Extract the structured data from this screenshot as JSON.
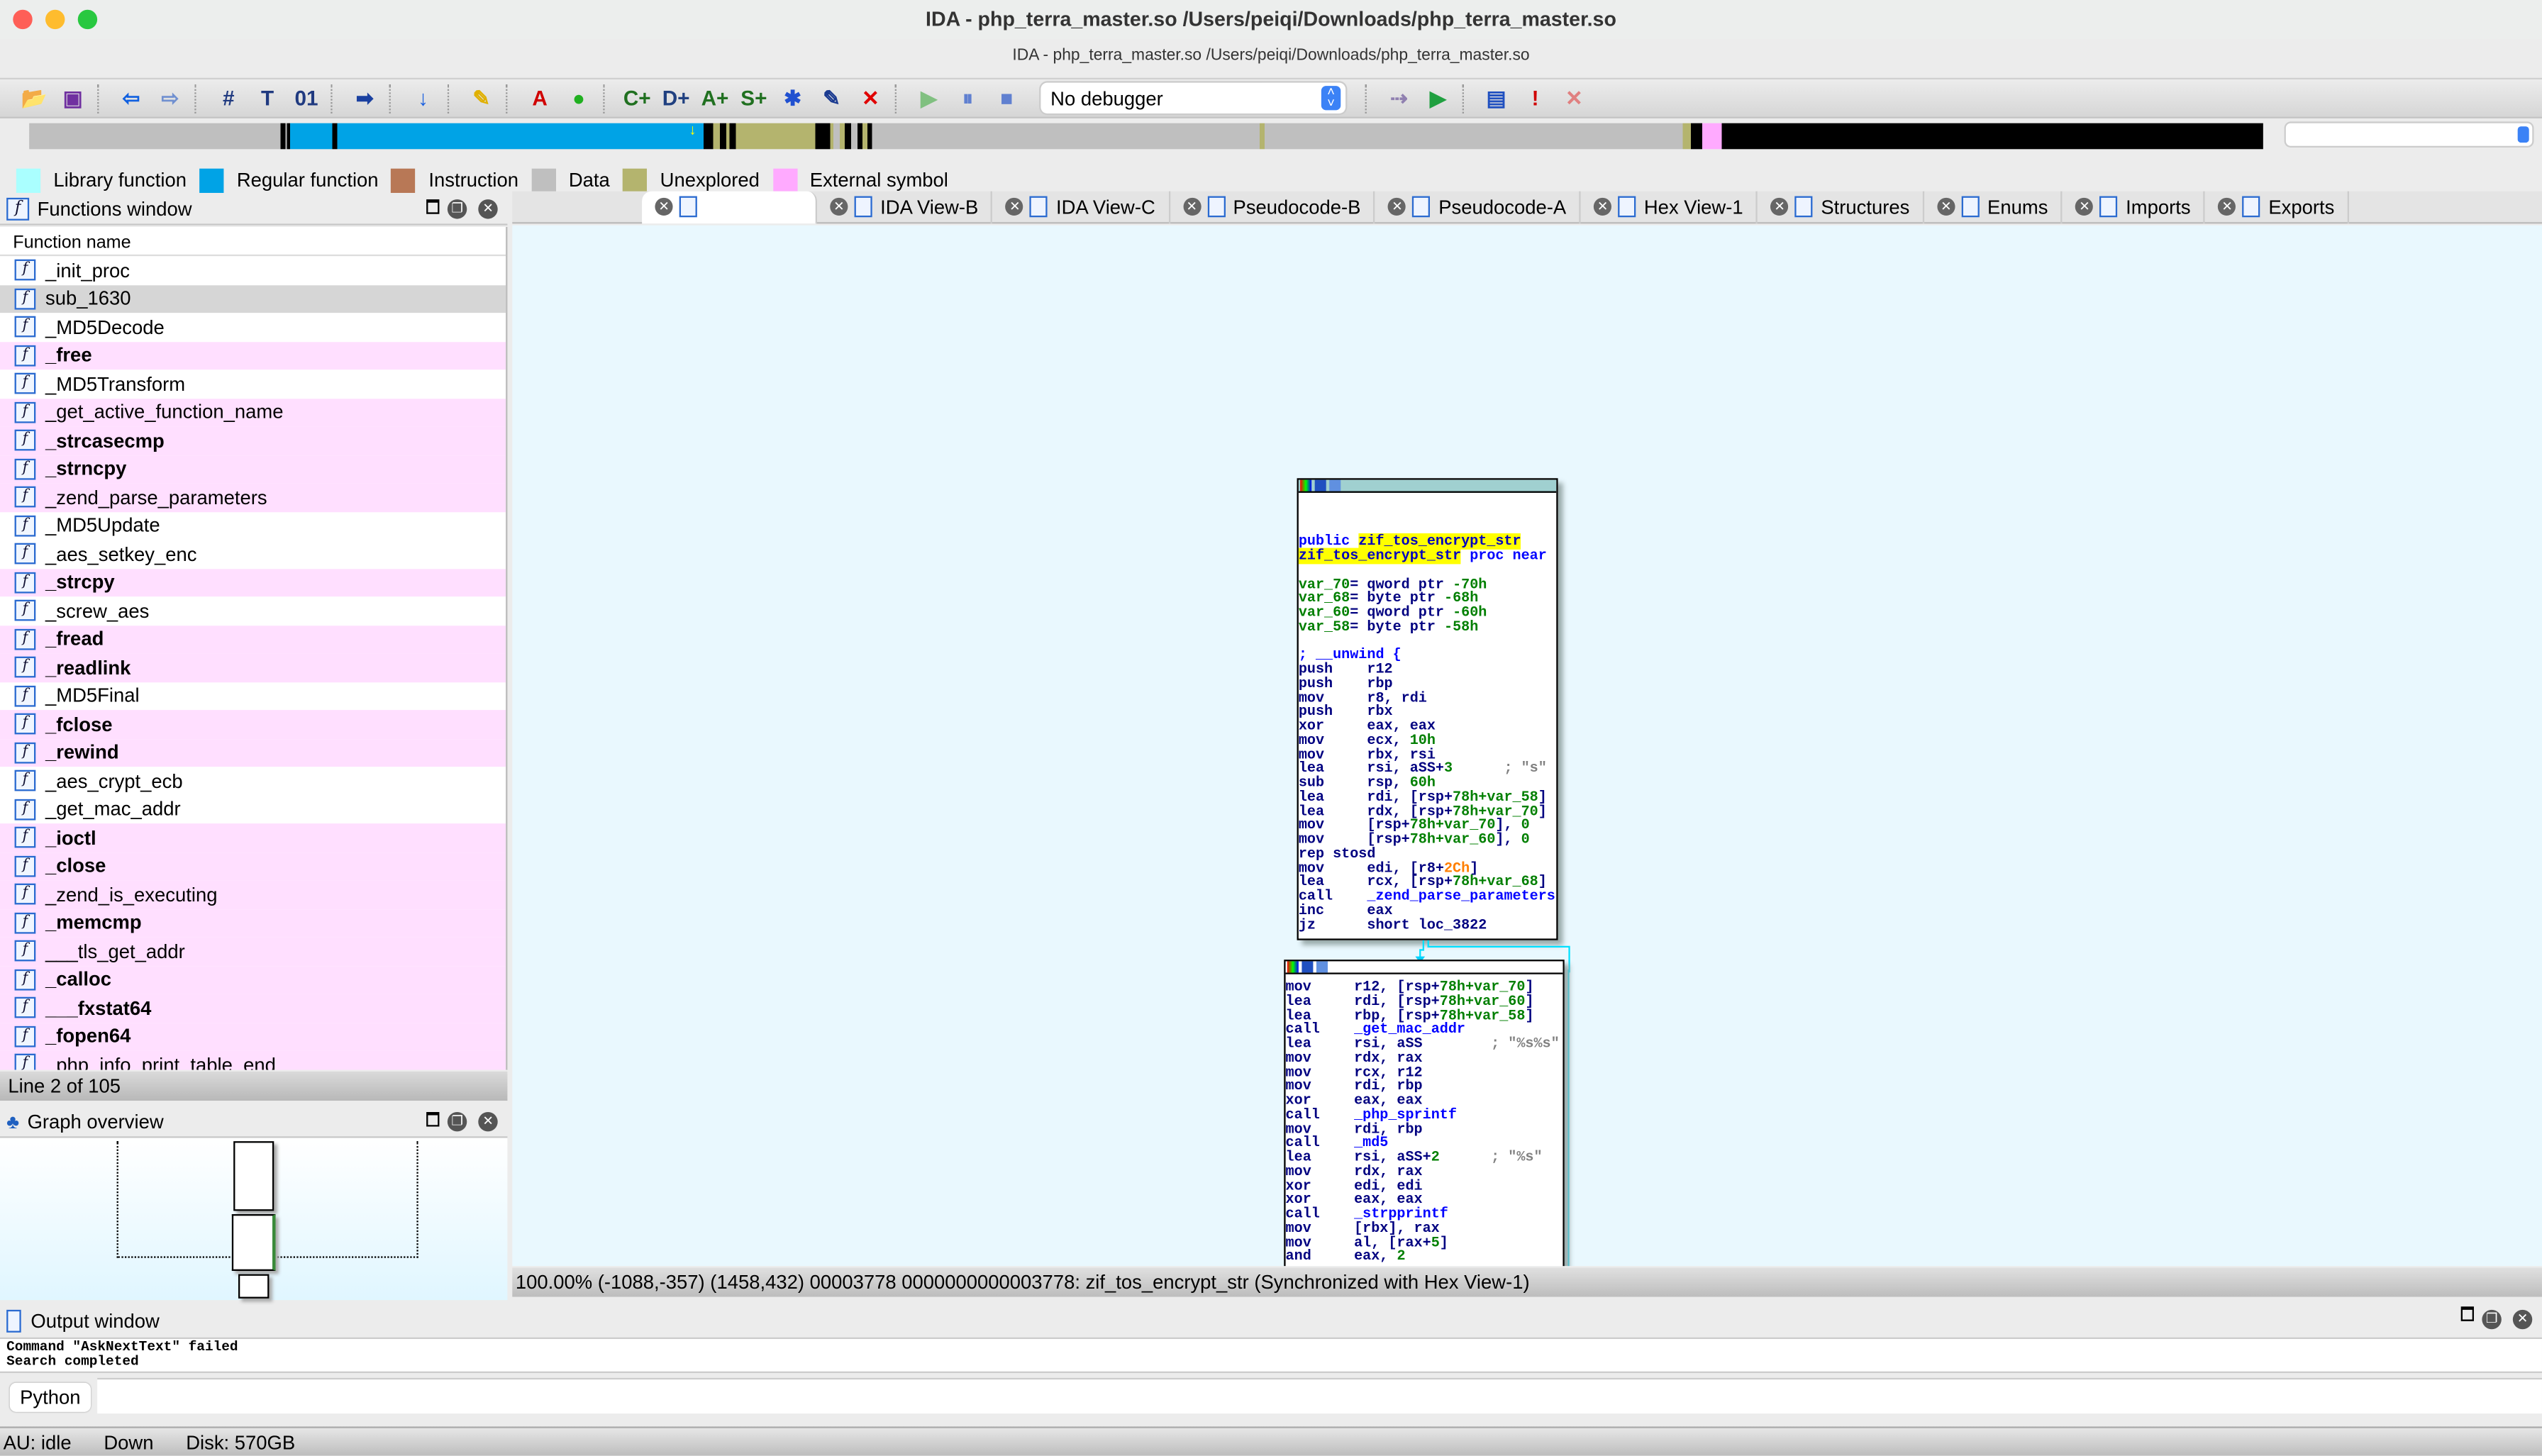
{
  "window": {
    "title": "IDA - php_terra_master.so /Users/peiqi/Downloads/php_terra_master.so",
    "subtitle": "IDA - php_terra_master.so /Users/peiqi/Downloads/php_terra_master.so"
  },
  "toolbar": {
    "icons": [
      {
        "name": "open-icon",
        "glyph": "📂",
        "color": "#d4a017"
      },
      {
        "name": "save-icon",
        "glyph": "▣",
        "color": "#7030a0"
      },
      {
        "sep": true
      },
      {
        "name": "back-icon",
        "glyph": "⇦",
        "color": "#1060e0"
      },
      {
        "name": "forward-icon",
        "glyph": "⇨",
        "color": "#7090d0"
      },
      {
        "sep": true
      },
      {
        "name": "search-sequence-icon",
        "glyph": "#",
        "color": "#203a80"
      },
      {
        "name": "search-text-icon",
        "glyph": "T",
        "color": "#203a80"
      },
      {
        "name": "search-binary-icon",
        "glyph": "01",
        "color": "#203a80"
      },
      {
        "sep": true
      },
      {
        "name": "jump-icon",
        "glyph": "➡",
        "color": "#1a40a0"
      },
      {
        "sep": true
      },
      {
        "name": "jump-down-icon",
        "glyph": "↓",
        "color": "#1a60e0"
      },
      {
        "sep": true
      },
      {
        "name": "flashlight-icon",
        "glyph": "✎",
        "color": "#e0b000"
      },
      {
        "sep": true
      },
      {
        "name": "strings-icon",
        "glyph": "A",
        "color": "#d00000"
      },
      {
        "name": "green-circle-icon",
        "glyph": "●",
        "color": "#20b020"
      },
      {
        "sep": true
      },
      {
        "name": "create-code-icon",
        "glyph": "C+",
        "color": "#207020"
      },
      {
        "name": "create-data-icon",
        "glyph": "D+",
        "color": "#204080"
      },
      {
        "name": "create-string-icon",
        "glyph": "A+",
        "color": "#207020"
      },
      {
        "name": "create-struct-icon",
        "glyph": "S+",
        "color": "#207020"
      },
      {
        "name": "enum-add-icon",
        "glyph": "✱",
        "color": "#2050d0"
      },
      {
        "name": "edit-icon",
        "glyph": "✎",
        "color": "#1a3a90"
      },
      {
        "name": "delete-icon",
        "glyph": "✕",
        "color": "#e00000"
      },
      {
        "sep": true
      },
      {
        "name": "play-icon",
        "glyph": "▶",
        "color": "#80c080"
      },
      {
        "name": "pause-icon",
        "glyph": "⏸",
        "color": "#6080d0"
      },
      {
        "name": "stop-icon",
        "glyph": "■",
        "color": "#6080d0"
      }
    ],
    "debugger_select": "No debugger",
    "icons_right": [
      {
        "name": "attach-icon",
        "glyph": "⇢",
        "color": "#9080b0"
      },
      {
        "name": "run-to-cursor-icon",
        "glyph": "▶",
        "color": "#20a040"
      },
      {
        "sep": true
      },
      {
        "name": "breakpoint-list-icon",
        "glyph": "▤",
        "color": "#2050c0"
      },
      {
        "name": "add-breakpoint-icon",
        "glyph": "!",
        "color": "#d00000"
      },
      {
        "name": "delete-breakpoint-icon",
        "glyph": "✕",
        "color": "#e08080"
      }
    ]
  },
  "legend": [
    {
      "label": "Library function",
      "color": "#aaffff"
    },
    {
      "label": "Regular function",
      "color": "#00a3e6"
    },
    {
      "label": "Instruction",
      "color": "#b87856"
    },
    {
      "label": "Data",
      "color": "#bfbfbf"
    },
    {
      "label": "Unexplored",
      "color": "#b4b46e"
    },
    {
      "label": "External symbol",
      "color": "#ffaaff"
    }
  ],
  "functions_window": {
    "title": "Functions window",
    "column": "Function name",
    "rows": [
      {
        "name": "_init_proc",
        "type": "regular"
      },
      {
        "name": "sub_1630",
        "type": "regular",
        "selected": true
      },
      {
        "name": "_MD5Decode",
        "type": "regular"
      },
      {
        "name": "_free",
        "type": "external",
        "bold": true
      },
      {
        "name": "_MD5Transform",
        "type": "regular"
      },
      {
        "name": "_get_active_function_name",
        "type": "external"
      },
      {
        "name": "_strcasecmp",
        "type": "external",
        "bold": true
      },
      {
        "name": "_strncpy",
        "type": "external",
        "bold": true
      },
      {
        "name": "_zend_parse_parameters",
        "type": "external"
      },
      {
        "name": "_MD5Update",
        "type": "regular"
      },
      {
        "name": "_aes_setkey_enc",
        "type": "regular"
      },
      {
        "name": "_strcpy",
        "type": "external",
        "bold": true
      },
      {
        "name": "_screw_aes",
        "type": "regular"
      },
      {
        "name": "_fread",
        "type": "external",
        "bold": true
      },
      {
        "name": "_readlink",
        "type": "external",
        "bold": true
      },
      {
        "name": "_MD5Final",
        "type": "regular"
      },
      {
        "name": "_fclose",
        "type": "external",
        "bold": true
      },
      {
        "name": "_rewind",
        "type": "external",
        "bold": true
      },
      {
        "name": "_aes_crypt_ecb",
        "type": "regular"
      },
      {
        "name": "_get_mac_addr",
        "type": "regular"
      },
      {
        "name": "_ioctl",
        "type": "external",
        "bold": true
      },
      {
        "name": "_close",
        "type": "external",
        "bold": true
      },
      {
        "name": "_zend_is_executing",
        "type": "external"
      },
      {
        "name": "_memcmp",
        "type": "external",
        "bold": true
      },
      {
        "name": "___tls_get_addr",
        "type": "external"
      },
      {
        "name": "_calloc",
        "type": "external",
        "bold": true
      },
      {
        "name": "___fxstat64",
        "type": "external",
        "bold": true
      },
      {
        "name": "_fopen64",
        "type": "external",
        "bold": true
      },
      {
        "name": "_php_info_print_table_end",
        "type": "external"
      }
    ],
    "status": "Line 2 of 105"
  },
  "graph_overview": {
    "title": "Graph overview"
  },
  "tabs": [
    {
      "label": "",
      "active": true
    },
    {
      "label": "IDA View-B"
    },
    {
      "label": "IDA View-C"
    },
    {
      "label": "Pseudocode-B"
    },
    {
      "label": "Pseudocode-A"
    },
    {
      "label": "Hex View-1"
    },
    {
      "label": "Structures"
    },
    {
      "label": "Enums"
    },
    {
      "label": "Imports"
    },
    {
      "label": "Exports"
    }
  ],
  "graph": {
    "blocks": [
      {
        "lines": [
          [],
          [],
          [],
          [
            [
              "b",
              "public "
            ],
            [
              "h",
              "zif_tos_encrypt_str"
            ]
          ],
          [
            [
              "h",
              "zif_tos_encrypt_str"
            ],
            [
              "b",
              " proc near"
            ]
          ],
          [],
          [
            [
              "g",
              "var_70"
            ],
            [
              "n",
              "= qword ptr "
            ],
            [
              "g",
              "-70h"
            ]
          ],
          [
            [
              "g",
              "var_68"
            ],
            [
              "n",
              "= byte ptr "
            ],
            [
              "g",
              "-68h"
            ]
          ],
          [
            [
              "g",
              "var_60"
            ],
            [
              "n",
              "= qword ptr "
            ],
            [
              "g",
              "-60h"
            ]
          ],
          [
            [
              "g",
              "var_58"
            ],
            [
              "n",
              "= byte ptr "
            ],
            [
              "g",
              "-58h"
            ]
          ],
          [],
          [
            [
              "b",
              "; __unwind {"
            ]
          ],
          [
            [
              "n",
              "push    r12"
            ]
          ],
          [
            [
              "n",
              "push    rbp"
            ]
          ],
          [
            [
              "n",
              "mov     r8, rdi"
            ]
          ],
          [
            [
              "n",
              "push    rbx"
            ]
          ],
          [
            [
              "n",
              "xor     eax, eax"
            ]
          ],
          [
            [
              "n",
              "mov     ecx, "
            ],
            [
              "g",
              "10h"
            ]
          ],
          [
            [
              "n",
              "mov     rbx, rsi"
            ]
          ],
          [
            [
              "n",
              "lea     rsi, aSS+"
            ],
            [
              "g",
              "3"
            ],
            [
              "c",
              "      ; \"s\""
            ]
          ],
          [
            [
              "n",
              "sub     rsp, "
            ],
            [
              "g",
              "60h"
            ]
          ],
          [
            [
              "n",
              "lea     rdi, [rsp+"
            ],
            [
              "g",
              "78h+var_58"
            ],
            [
              "n",
              "]"
            ]
          ],
          [
            [
              "n",
              "lea     rdx, [rsp+"
            ],
            [
              "g",
              "78h+var_70"
            ],
            [
              "n",
              "]"
            ]
          ],
          [
            [
              "n",
              "mov     [rsp+"
            ],
            [
              "g",
              "78h+var_70"
            ],
            [
              "n",
              "], "
            ],
            [
              "g",
              "0"
            ]
          ],
          [
            [
              "n",
              "mov     [rsp+"
            ],
            [
              "g",
              "78h+var_60"
            ],
            [
              "n",
              "], "
            ],
            [
              "g",
              "0"
            ]
          ],
          [
            [
              "n",
              "rep stosd"
            ]
          ],
          [
            [
              "n",
              "mov     edi, [r8+"
            ],
            [
              "o",
              "2Ch"
            ],
            [
              "n",
              "]"
            ]
          ],
          [
            [
              "n",
              "lea     rcx, [rsp+"
            ],
            [
              "g",
              "78h+var_68"
            ],
            [
              "n",
              "]"
            ]
          ],
          [
            [
              "n",
              "call    "
            ],
            [
              "b",
              "_zend_parse_parameters"
            ]
          ],
          [
            [
              "n",
              "inc     eax"
            ]
          ],
          [
            [
              "n",
              "jz      short loc_3822"
            ]
          ]
        ]
      },
      {
        "lines": [
          [
            [
              "n",
              "mov     r12, [rsp+"
            ],
            [
              "g",
              "78h+var_70"
            ],
            [
              "n",
              "]"
            ]
          ],
          [
            [
              "n",
              "lea     rdi, [rsp+"
            ],
            [
              "g",
              "78h+var_60"
            ],
            [
              "n",
              "]"
            ]
          ],
          [
            [
              "n",
              "lea     rbp, [rsp+"
            ],
            [
              "g",
              "78h+var_58"
            ],
            [
              "n",
              "]"
            ]
          ],
          [
            [
              "n",
              "call    "
            ],
            [
              "b",
              "_get_mac_addr"
            ]
          ],
          [
            [
              "n",
              "lea     rsi, aSS"
            ],
            [
              "c",
              "        ; \"%s%s\""
            ]
          ],
          [
            [
              "n",
              "mov     rdx, rax"
            ]
          ],
          [
            [
              "n",
              "mov     rcx, r12"
            ]
          ],
          [
            [
              "n",
              "mov     rdi, rbp"
            ]
          ],
          [
            [
              "n",
              "xor     eax, eax"
            ]
          ],
          [
            [
              "n",
              "call    "
            ],
            [
              "b",
              "_php_sprintf"
            ]
          ],
          [
            [
              "n",
              "mov     rdi, rbp"
            ]
          ],
          [
            [
              "n",
              "call    "
            ],
            [
              "b",
              "_md5"
            ]
          ],
          [
            [
              "n",
              "lea     rsi, aSS+"
            ],
            [
              "g",
              "2"
            ],
            [
              "c",
              "      ; \"%s\""
            ]
          ],
          [
            [
              "n",
              "mov     rdx, rax"
            ]
          ],
          [
            [
              "n",
              "xor     edi, edi"
            ]
          ],
          [
            [
              "n",
              "xor     eax, eax"
            ]
          ],
          [
            [
              "n",
              "call    "
            ],
            [
              "b",
              "_strpprintf"
            ]
          ],
          [
            [
              "n",
              "mov     [rbx], rax"
            ]
          ],
          [
            [
              "n",
              "mov     al, [rax+"
            ],
            [
              "g",
              "5"
            ],
            [
              "n",
              "]"
            ]
          ],
          [
            [
              "n",
              "and     eax, "
            ],
            [
              "g",
              "2"
            ]
          ]
        ]
      }
    ],
    "status": "100.00% (-1088,-357) (1458,432) 00003778 0000000000003778: zif_tos_encrypt_str (Synchronized with Hex View-1)"
  },
  "output_window": {
    "title": "Output window",
    "text": "Command \"AskNextText\" failed\nSearch completed",
    "python_button": "Python"
  },
  "statusbar": {
    "au": "AU:  idle",
    "direction": "Down",
    "disk": "Disk: 570GB"
  }
}
